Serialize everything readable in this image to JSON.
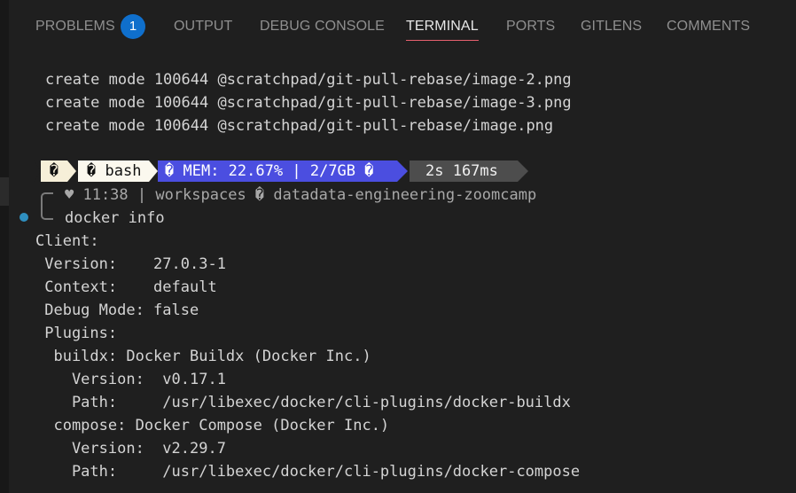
{
  "panel": {
    "tabs": [
      {
        "label": "PROBLEMS",
        "badge": "1"
      },
      {
        "label": "OUTPUT"
      },
      {
        "label": "DEBUG CONSOLE"
      },
      {
        "label": "TERMINAL",
        "active": true
      },
      {
        "label": "PORTS"
      },
      {
        "label": "GITLENS"
      },
      {
        "label": "COMMENTS"
      }
    ]
  },
  "terminal": {
    "previous_output": [
      "create mode 100644 @scratchpad/git-pull-rebase/image-2.png",
      "create mode 100644 @scratchpad/git-pull-rebase/image-3.png",
      "create mode 100644 @scratchpad/git-pull-rebase/image.png"
    ],
    "prompt_bar": {
      "icon_segment": "�",
      "shell_icon": "�",
      "shell": "bash",
      "mem_icon": "�",
      "mem_label": "MEM: 22.67%",
      "separator": "|",
      "mem_usage": "2/7GB",
      "mem_trailing_icon": "�",
      "duration": "2s 167ms"
    },
    "status_line": "♥ 11:38 | workspaces � datadata-engineering-zoomcamp",
    "command": "docker info",
    "output": [
      "Client:",
      " Version:    27.0.3-1",
      " Context:    default",
      " Debug Mode: false",
      " Plugins:",
      "  buildx: Docker Buildx (Docker Inc.)",
      "    Version:  v0.17.1",
      "    Path:     /usr/libexec/docker/cli-plugins/docker-buildx",
      "  compose: Docker Compose (Docker Inc.)",
      "    Version:  v2.29.7",
      "    Path:     /usr/libexec/docker/cli-plugins/docker-compose"
    ]
  },
  "colors": {
    "background": "#1f1f1f",
    "active_tab_underline": "#e8616f",
    "badge": "#0f6fcc",
    "mem_segment": "#4b4ee0",
    "time_segment": "#4d4d4d",
    "shell_segment": "#fbf8ee",
    "command_decoration_dot": "#2f8fbf"
  }
}
